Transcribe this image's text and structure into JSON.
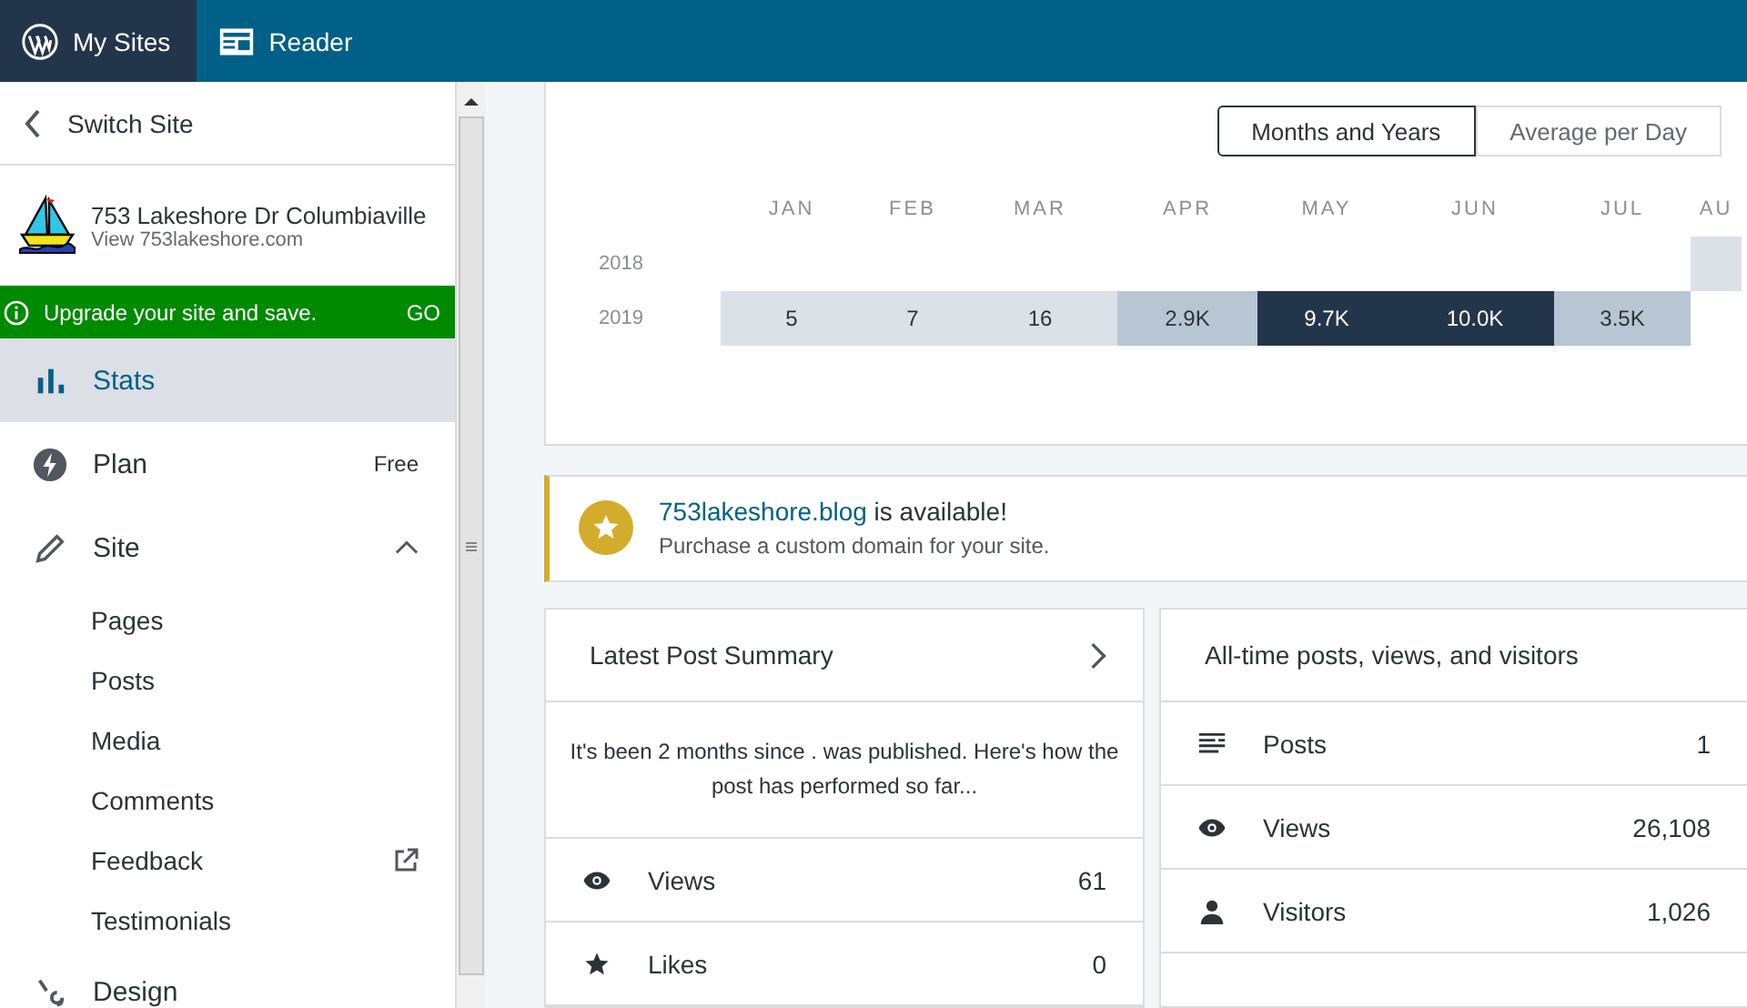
{
  "topbar": {
    "tabs": [
      {
        "label": "My Sites",
        "selected": true,
        "kind": "wp"
      },
      {
        "label": "Reader",
        "selected": false,
        "kind": "reader"
      }
    ]
  },
  "sidebar": {
    "switch_site": "Switch Site",
    "site_title": "753 Lakeshore Dr Columbiaville",
    "site_url": "View 753lakeshore.com",
    "upgrade": {
      "text": "Upgrade your site and save.",
      "action": "GO"
    },
    "items": [
      {
        "kind": "stats",
        "label": "Stats",
        "selected": true
      },
      {
        "kind": "plan",
        "label": "Plan",
        "badge": "Free",
        "selected": false
      },
      {
        "kind": "site",
        "label": "Site",
        "selected": false,
        "expanded": true,
        "children": [
          {
            "label": "Pages",
            "external": false
          },
          {
            "label": "Posts",
            "external": false
          },
          {
            "label": "Media",
            "external": false
          },
          {
            "label": "Comments",
            "external": false
          },
          {
            "label": "Feedback",
            "external": true
          },
          {
            "label": "Testimonials",
            "external": false
          }
        ]
      },
      {
        "kind": "design",
        "label": "Design",
        "selected": false
      }
    ]
  },
  "heatmap": {
    "toggle": [
      {
        "label": "Months and Years",
        "selected": true
      },
      {
        "label": "Average per Day",
        "selected": false
      }
    ],
    "columns": [
      "JAN",
      "FEB",
      "MAR",
      "APR",
      "MAY",
      "JUN",
      "JUL",
      "AU"
    ],
    "rows": [
      {
        "year": "2018",
        "cells": [
          null,
          null,
          null,
          null,
          null,
          null,
          null,
          {
            "color": "#dce1e7"
          }
        ]
      },
      {
        "year": "2019",
        "cells": [
          {
            "value": "5",
            "color": "#dce1e7"
          },
          {
            "value": "7",
            "color": "#dce1e7"
          },
          {
            "value": "16",
            "color": "#dce1e7"
          },
          {
            "value": "2.9K",
            "color": "#b8c6d3"
          },
          {
            "value": "9.7K",
            "color": "#23354b"
          },
          {
            "value": "10.0K",
            "color": "#23354b"
          },
          {
            "value": "3.5K",
            "color": "#b8c6d3"
          },
          null
        ]
      }
    ]
  },
  "notice": {
    "domain": "753lakeshore.blog",
    "title_rest": "is available!",
    "subtitle": "Purchase a custom domain for your site."
  },
  "latest_post": {
    "title": "Latest Post Summary",
    "text": "It's been 2 months since . was published. Here's how the post has performed so far...",
    "rows": [
      {
        "kind": "views",
        "label": "Views",
        "value": "61"
      },
      {
        "kind": "likes",
        "label": "Likes",
        "value": "0"
      }
    ]
  },
  "all_time": {
    "title": "All-time posts, views, and visitors",
    "rows": [
      {
        "kind": "posts",
        "label": "Posts",
        "value": "1"
      },
      {
        "kind": "views",
        "label": "Views",
        "value": "26,108"
      },
      {
        "kind": "visitors",
        "label": "Visitors",
        "value": "1,026"
      }
    ]
  }
}
